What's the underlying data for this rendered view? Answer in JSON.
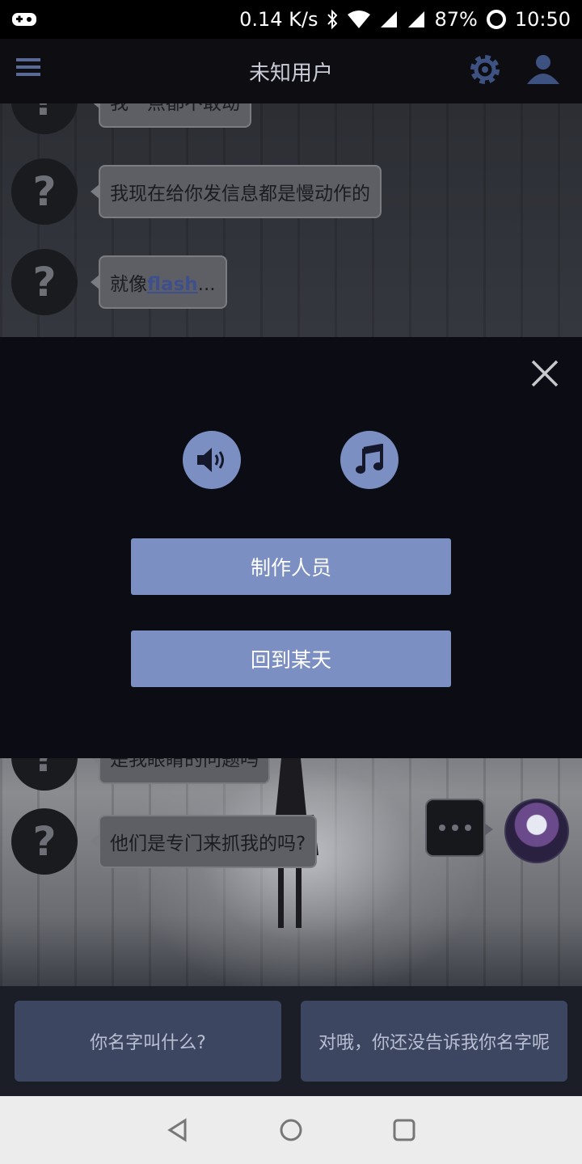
{
  "status_bar": {
    "net_speed": "0.14 K/s",
    "battery": "87%",
    "time": "10:50",
    "icons": [
      "game-controller-icon",
      "bluetooth-icon",
      "wifi-icon",
      "cell-signal-icon",
      "battery-ring-icon"
    ]
  },
  "header": {
    "title": "未知用户",
    "icons": [
      "menu-icon",
      "gear-icon",
      "person-icon"
    ]
  },
  "chat": {
    "messages": [
      {
        "avatar": "?",
        "text": "我一点都不敢动"
      },
      {
        "avatar": "?",
        "text": "我现在给你发信息都是慢动作的"
      },
      {
        "avatar": "?",
        "prefix": "就像",
        "link": "flash",
        "suffix": "..."
      },
      {
        "avatar": "?",
        "text": "是我眼睛的问题吗"
      },
      {
        "avatar": "?",
        "text": "他们是专门来抓我的吗?"
      }
    ],
    "typing_dots": "•••"
  },
  "dialog": {
    "sound_icon": "speaker-icon",
    "music_icon": "music-note-icon",
    "credits_label": "制作人员",
    "back_label": "回到某天",
    "close_icon": "close-icon"
  },
  "replies": [
    "你名字叫什么?",
    "对哦，你还没告诉我你名字呢"
  ],
  "nav": [
    "back-icon",
    "home-icon",
    "recents-icon"
  ],
  "colors": {
    "accent": "#7b8fc2",
    "dialog_bg": "#0c0c15",
    "reply_bg": "#3d4660",
    "bubble_bg": "#5d5f65"
  }
}
